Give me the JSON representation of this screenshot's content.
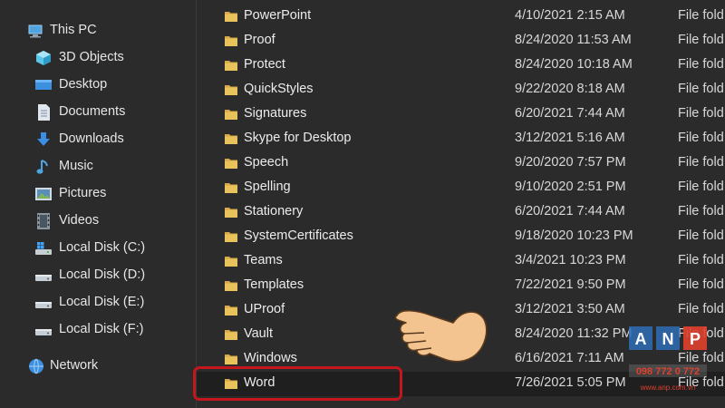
{
  "sidebar": {
    "items": [
      {
        "label": "This PC",
        "icon": "computer-icon"
      },
      {
        "label": "3D Objects",
        "icon": "cube-icon"
      },
      {
        "label": "Desktop",
        "icon": "desktop-icon"
      },
      {
        "label": "Documents",
        "icon": "document-icon"
      },
      {
        "label": "Downloads",
        "icon": "download-arrow-icon"
      },
      {
        "label": "Music",
        "icon": "music-note-icon"
      },
      {
        "label": "Pictures",
        "icon": "picture-icon"
      },
      {
        "label": "Videos",
        "icon": "film-icon"
      },
      {
        "label": "Local Disk (C:)",
        "icon": "windows-drive-icon"
      },
      {
        "label": "Local Disk (D:)",
        "icon": "drive-icon"
      },
      {
        "label": "Local Disk (E:)",
        "icon": "drive-icon"
      },
      {
        "label": "Local Disk (F:)",
        "icon": "drive-icon"
      },
      {
        "label": "Network",
        "icon": "network-icon"
      }
    ]
  },
  "files": [
    {
      "name": "PowerPoint",
      "date": "4/10/2021 2:15 AM",
      "type": "File fold"
    },
    {
      "name": "Proof",
      "date": "8/24/2020 11:53 AM",
      "type": "File fold"
    },
    {
      "name": "Protect",
      "date": "8/24/2020 10:18 AM",
      "type": "File fold"
    },
    {
      "name": "QuickStyles",
      "date": "9/22/2020 8:18 AM",
      "type": "File fold"
    },
    {
      "name": "Signatures",
      "date": "6/20/2021 7:44 AM",
      "type": "File fold"
    },
    {
      "name": "Skype for Desktop",
      "date": "3/12/2021 5:16 AM",
      "type": "File fold"
    },
    {
      "name": "Speech",
      "date": "9/20/2020 7:57 PM",
      "type": "File fold"
    },
    {
      "name": "Spelling",
      "date": "9/10/2020 2:51 PM",
      "type": "File fold"
    },
    {
      "name": "Stationery",
      "date": "6/20/2021 7:44 AM",
      "type": "File fold"
    },
    {
      "name": "SystemCertificates",
      "date": "9/18/2020 10:23 PM",
      "type": "File fold"
    },
    {
      "name": "Teams",
      "date": "3/4/2021 10:23 PM",
      "type": "File fold"
    },
    {
      "name": "Templates",
      "date": "7/22/2021 9:50 PM",
      "type": "File fold"
    },
    {
      "name": "UProof",
      "date": "3/12/2021 3:50 AM",
      "type": "File fold"
    },
    {
      "name": "Vault",
      "date": "8/24/2020 11:32 PM",
      "type": "File fold"
    },
    {
      "name": "Windows",
      "date": "6/16/2021 7:11 AM",
      "type": "File fold"
    },
    {
      "name": "Word",
      "date": "7/26/2021 5:05 PM",
      "type": "File fold",
      "selected": true
    }
  ],
  "watermark": {
    "brand": "ANP",
    "phone": "098 772 0 772",
    "site": "www.anp.com.vn"
  },
  "colors": {
    "folder": "#e8c25a",
    "highlight": "#c4161c",
    "hand": "#f3c48f"
  }
}
